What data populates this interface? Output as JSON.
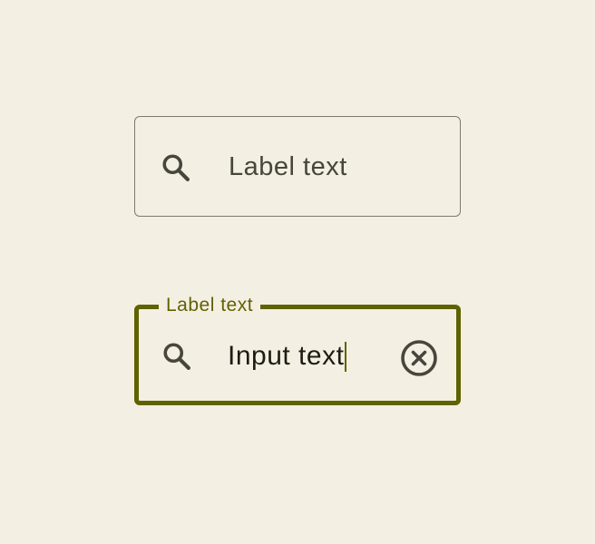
{
  "search_field_default": {
    "placeholder": "Label text",
    "leading_icon": "search-icon"
  },
  "search_field_focused": {
    "label": "Label text",
    "value": "Input text",
    "leading_icon": "search-icon",
    "trailing_icon": "clear-icon"
  },
  "colors": {
    "background": "#f4efe3",
    "outline": "#7c7a6a",
    "focused_outline": "#5f6200",
    "text": "#47463c",
    "input_text": "#1d1c14"
  }
}
